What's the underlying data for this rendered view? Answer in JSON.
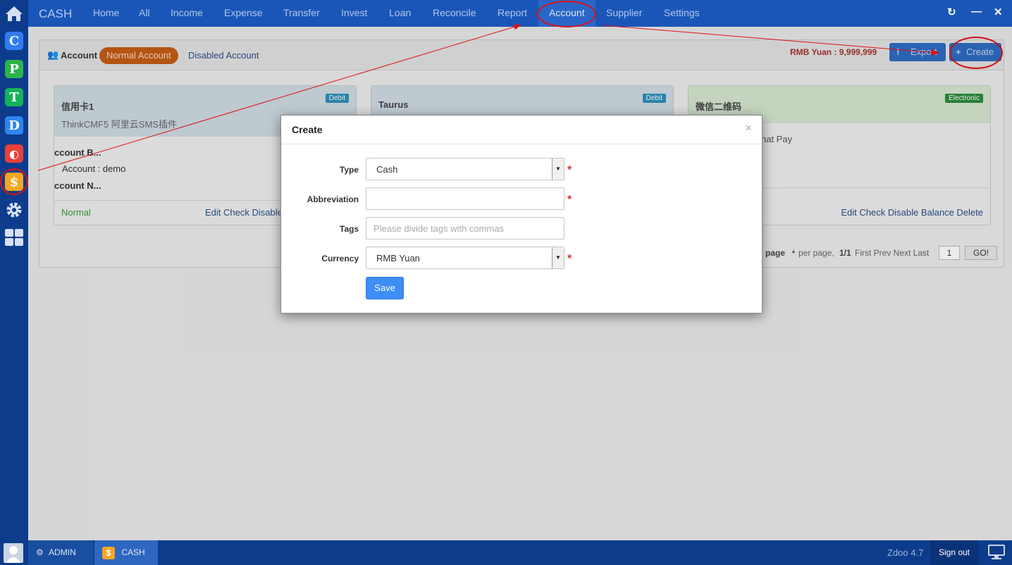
{
  "top_nav": {
    "brand": "CASH",
    "items": [
      "Home",
      "All",
      "Income",
      "Expense",
      "Transfer",
      "Invest",
      "Loan",
      "Reconcile",
      "Report",
      "Account",
      "Supplier",
      "Settings"
    ],
    "active": "Account"
  },
  "dock": {
    "apps": [
      {
        "letter": "C",
        "color": "#2f7cf0"
      },
      {
        "letter": "P",
        "color": "#2db34a"
      },
      {
        "letter": "T",
        "color": "#14b35a"
      },
      {
        "letter": "D",
        "color": "#2f86ee"
      },
      {
        "letter": "◐",
        "color": "#e8403a"
      },
      {
        "letter": "$",
        "color": "#f5a623"
      }
    ]
  },
  "panel": {
    "heading": "Account",
    "tabs": [
      "Normal Account",
      "Disabled Account"
    ],
    "total": "RMB Yuan : 9,999,999",
    "export_label": "Export",
    "create_label": "Create",
    "cards": [
      {
        "title": "信用卡1",
        "sub": "ThinkCMF5 阿里云SMS插件",
        "badge": "Debit",
        "lines": [
          "ccount B...",
          "Account :  demo",
          "ccount N..."
        ],
        "status": "Normal",
        "actions": "Edit Check Disable"
      },
      {
        "title": "Taurus",
        "sub": "",
        "badge": "Debit",
        "lines": [],
        "status": "",
        "actions": ""
      },
      {
        "title": "微信二维码",
        "sub": "",
        "badge": "Electronic",
        "lines": [
          "hat Pay"
        ],
        "status": "",
        "actions": "Edit Check Disable Balance Delete"
      }
    ],
    "pager": {
      "page_word": "page",
      "per_page": "per page,",
      "fraction": "1/1",
      "links": "First Prev Next Last",
      "page_input": "1",
      "go": "GO!"
    }
  },
  "modal": {
    "title": "Create",
    "close": "×",
    "fields": {
      "type": {
        "label": "Type",
        "value": "Cash",
        "required": "*"
      },
      "abbreviation": {
        "label": "Abbreviation",
        "value": "",
        "required": "*"
      },
      "tags": {
        "label": "Tags",
        "placeholder": "Please divide tags with commas"
      },
      "currency": {
        "label": "Currency",
        "value": "RMB Yuan",
        "required": "*"
      }
    },
    "save_label": "Save"
  },
  "taskbar": {
    "user": "ADMIN",
    "app": "CASH",
    "version": "Zdoo 4.7",
    "signout": "Sign out"
  }
}
